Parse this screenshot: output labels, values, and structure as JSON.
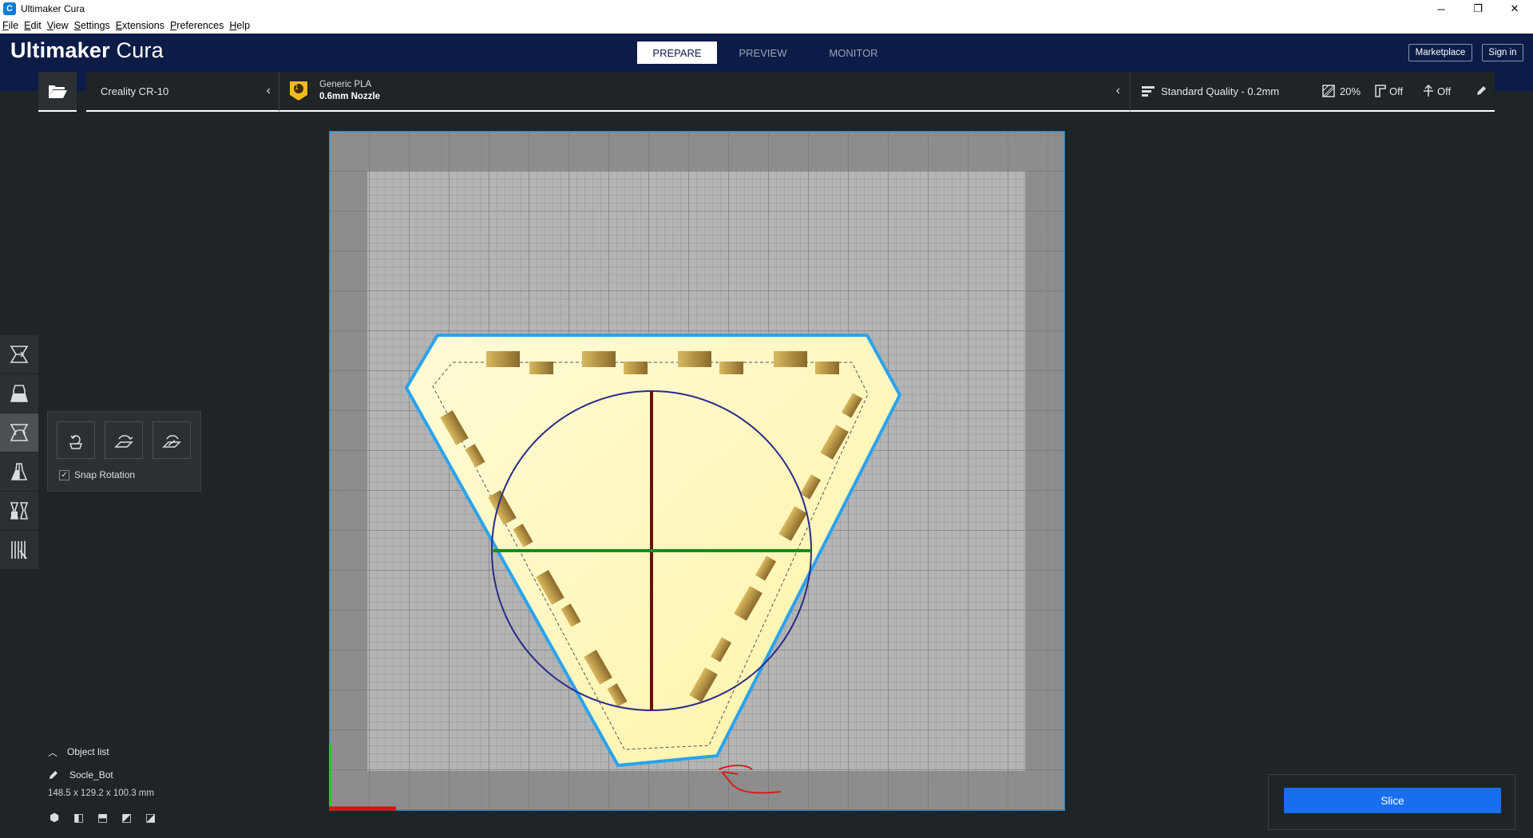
{
  "window": {
    "title": "Ultimaker Cura",
    "app_icon": "C",
    "minimize": "─",
    "restore": "❐",
    "close": "✕"
  },
  "menu": [
    "File",
    "Edit",
    "View",
    "Settings",
    "Extensions",
    "Preferences",
    "Help"
  ],
  "header": {
    "logo_bold": "Ultimaker",
    "logo_light": " Cura",
    "tabs": [
      "PREPARE",
      "PREVIEW",
      "MONITOR"
    ],
    "marketplace": "Marketplace",
    "signin": "Sign in"
  },
  "config": {
    "printer": "Creality CR-10",
    "material_badge": "1",
    "material": "Generic PLA",
    "nozzle": "0.6mm Nozzle",
    "profile": "Standard Quality - 0.2mm",
    "infill": "20%",
    "support": "Off",
    "adhesion": "Off"
  },
  "tool_panel": {
    "snap_label": "Snap Rotation",
    "snap_checked": "✓"
  },
  "object_list": {
    "label": "Object list",
    "object_name": "Socle_Bot",
    "dimensions": "148.5 x 129.2 x 100.3 mm"
  },
  "slice": {
    "label": "Slice"
  },
  "colors": {
    "header_bg": "#0c1c47",
    "accent": "#196ef0",
    "model": "#fff8c2",
    "outline": "#29a3ef"
  }
}
